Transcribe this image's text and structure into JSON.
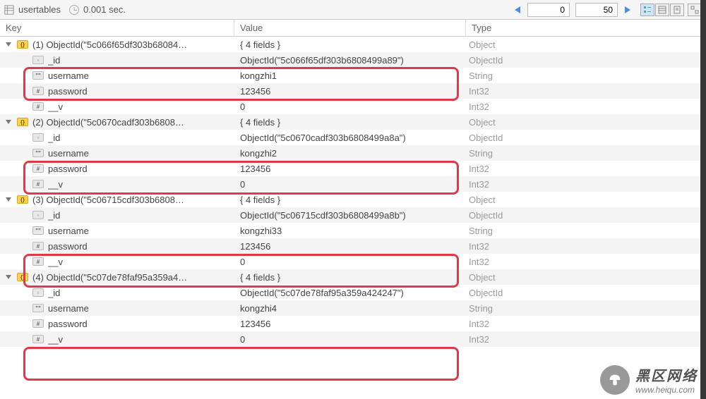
{
  "toolbar": {
    "title": "usertables",
    "elapsed": "0.001 sec.",
    "offset": "0",
    "limit": "50"
  },
  "headers": {
    "key": "Key",
    "value": "Value",
    "type": "Type"
  },
  "types": {
    "object": "Object",
    "objectid": "ObjectId",
    "string": "String",
    "int32": "Int32"
  },
  "field_summary": "{ 4 fields }",
  "docs": [
    {
      "idx": "(1)",
      "key_trunc": "ObjectId(\"5c066f65df303b68084…",
      "id_full": "ObjectId(\"5c066f65df303b6808499a89\")",
      "username": "kongzhi1",
      "password": "123456",
      "v": "0"
    },
    {
      "idx": "(2)",
      "key_trunc": "ObjectId(\"5c0670cadf303b6808…",
      "id_full": "ObjectId(\"5c0670cadf303b6808499a8a\")",
      "username": "kongzhi2",
      "password": "123456",
      "v": "0"
    },
    {
      "idx": "(3)",
      "key_trunc": "ObjectId(\"5c06715cdf303b6808…",
      "id_full": "ObjectId(\"5c06715cdf303b6808499a8b\")",
      "username": "kongzhi33",
      "password": "123456",
      "v": "0"
    },
    {
      "idx": "(4)",
      "key_trunc": "ObjectId(\"5c07de78faf95a359a4…",
      "id_full": "ObjectId(\"5c07de78faf95a359a424247\")",
      "username": "kongzhi4",
      "password": "123456",
      "v": "0"
    }
  ],
  "labels": {
    "id": "_id",
    "username": "username",
    "password": "password",
    "v": "__v"
  },
  "watermark": {
    "cn": "黑区网络",
    "url": "www.heiqu.com"
  }
}
